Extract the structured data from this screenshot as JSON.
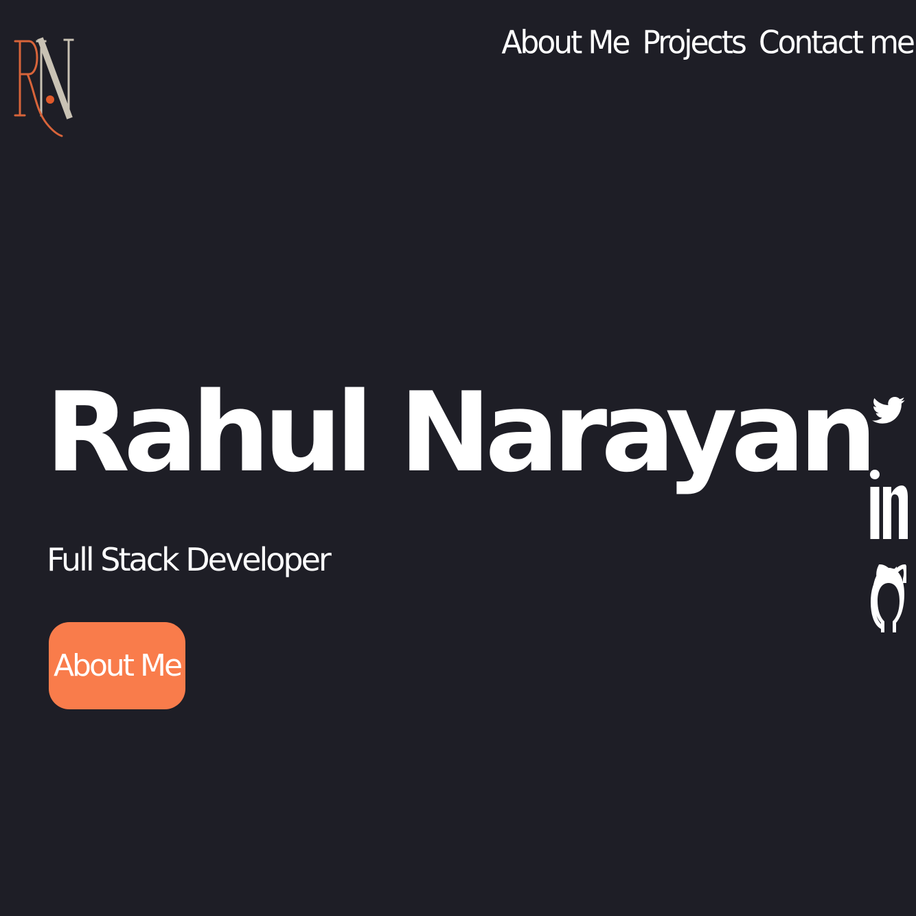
{
  "logo": {
    "icon": "rn-monogram-logo",
    "letters": "RN",
    "colors": {
      "r": "#d8643a",
      "n": "#c9c2b4",
      "dot": "#e05a2b"
    }
  },
  "nav": {
    "items": [
      {
        "label": "About Me"
      },
      {
        "label": "Projects"
      },
      {
        "label": "Contact me"
      }
    ]
  },
  "hero": {
    "name": "Rahul Narayan",
    "role": "Full Stack Developer",
    "cta_label": "About Me"
  },
  "social": {
    "items": [
      {
        "icon": "twitter-icon"
      },
      {
        "icon": "linkedin-icon"
      },
      {
        "icon": "github-icon"
      }
    ]
  },
  "theme": {
    "background": "#1e1e26",
    "accent": "#f97c4b",
    "text": "#ffffff"
  }
}
